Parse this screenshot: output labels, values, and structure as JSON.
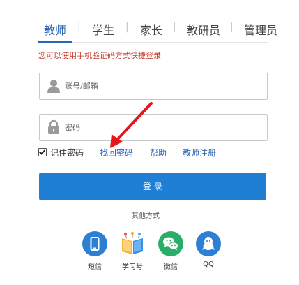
{
  "tabs": [
    {
      "label": "教师",
      "active": true
    },
    {
      "label": "学生",
      "active": false
    },
    {
      "label": "家长",
      "active": false
    },
    {
      "label": "教研员",
      "active": false
    },
    {
      "label": "管理员",
      "active": false
    }
  ],
  "tab_separator": "|",
  "tip": "您可以使用手机验证码方式快捷登录",
  "account_field": {
    "placeholder": "账号/邮箱",
    "icon": "user-icon"
  },
  "password_field": {
    "placeholder": "密码",
    "icon": "lock-icon"
  },
  "remember": {
    "label": "记住密码",
    "checked": true
  },
  "links": {
    "forgot": "找回密码",
    "help": "帮助",
    "register": "教师注册"
  },
  "login_button": "登 录",
  "other_methods": {
    "title": "其他方式",
    "items": [
      {
        "label": "短信",
        "icon": "phone-icon",
        "color": "#2d7fd3"
      },
      {
        "label": "学习号",
        "icon": "book-icon",
        "color": "#f2a33a"
      },
      {
        "label": "微信",
        "icon": "wechat-icon",
        "color": "#2aae67"
      },
      {
        "label": "QQ",
        "icon": "qq-icon",
        "color": "#2d7fd3"
      }
    ]
  },
  "colors": {
    "accent": "#2a66b6",
    "button": "#1e7fd4",
    "tip": "#c0392b",
    "arrow": "#e8141c"
  }
}
